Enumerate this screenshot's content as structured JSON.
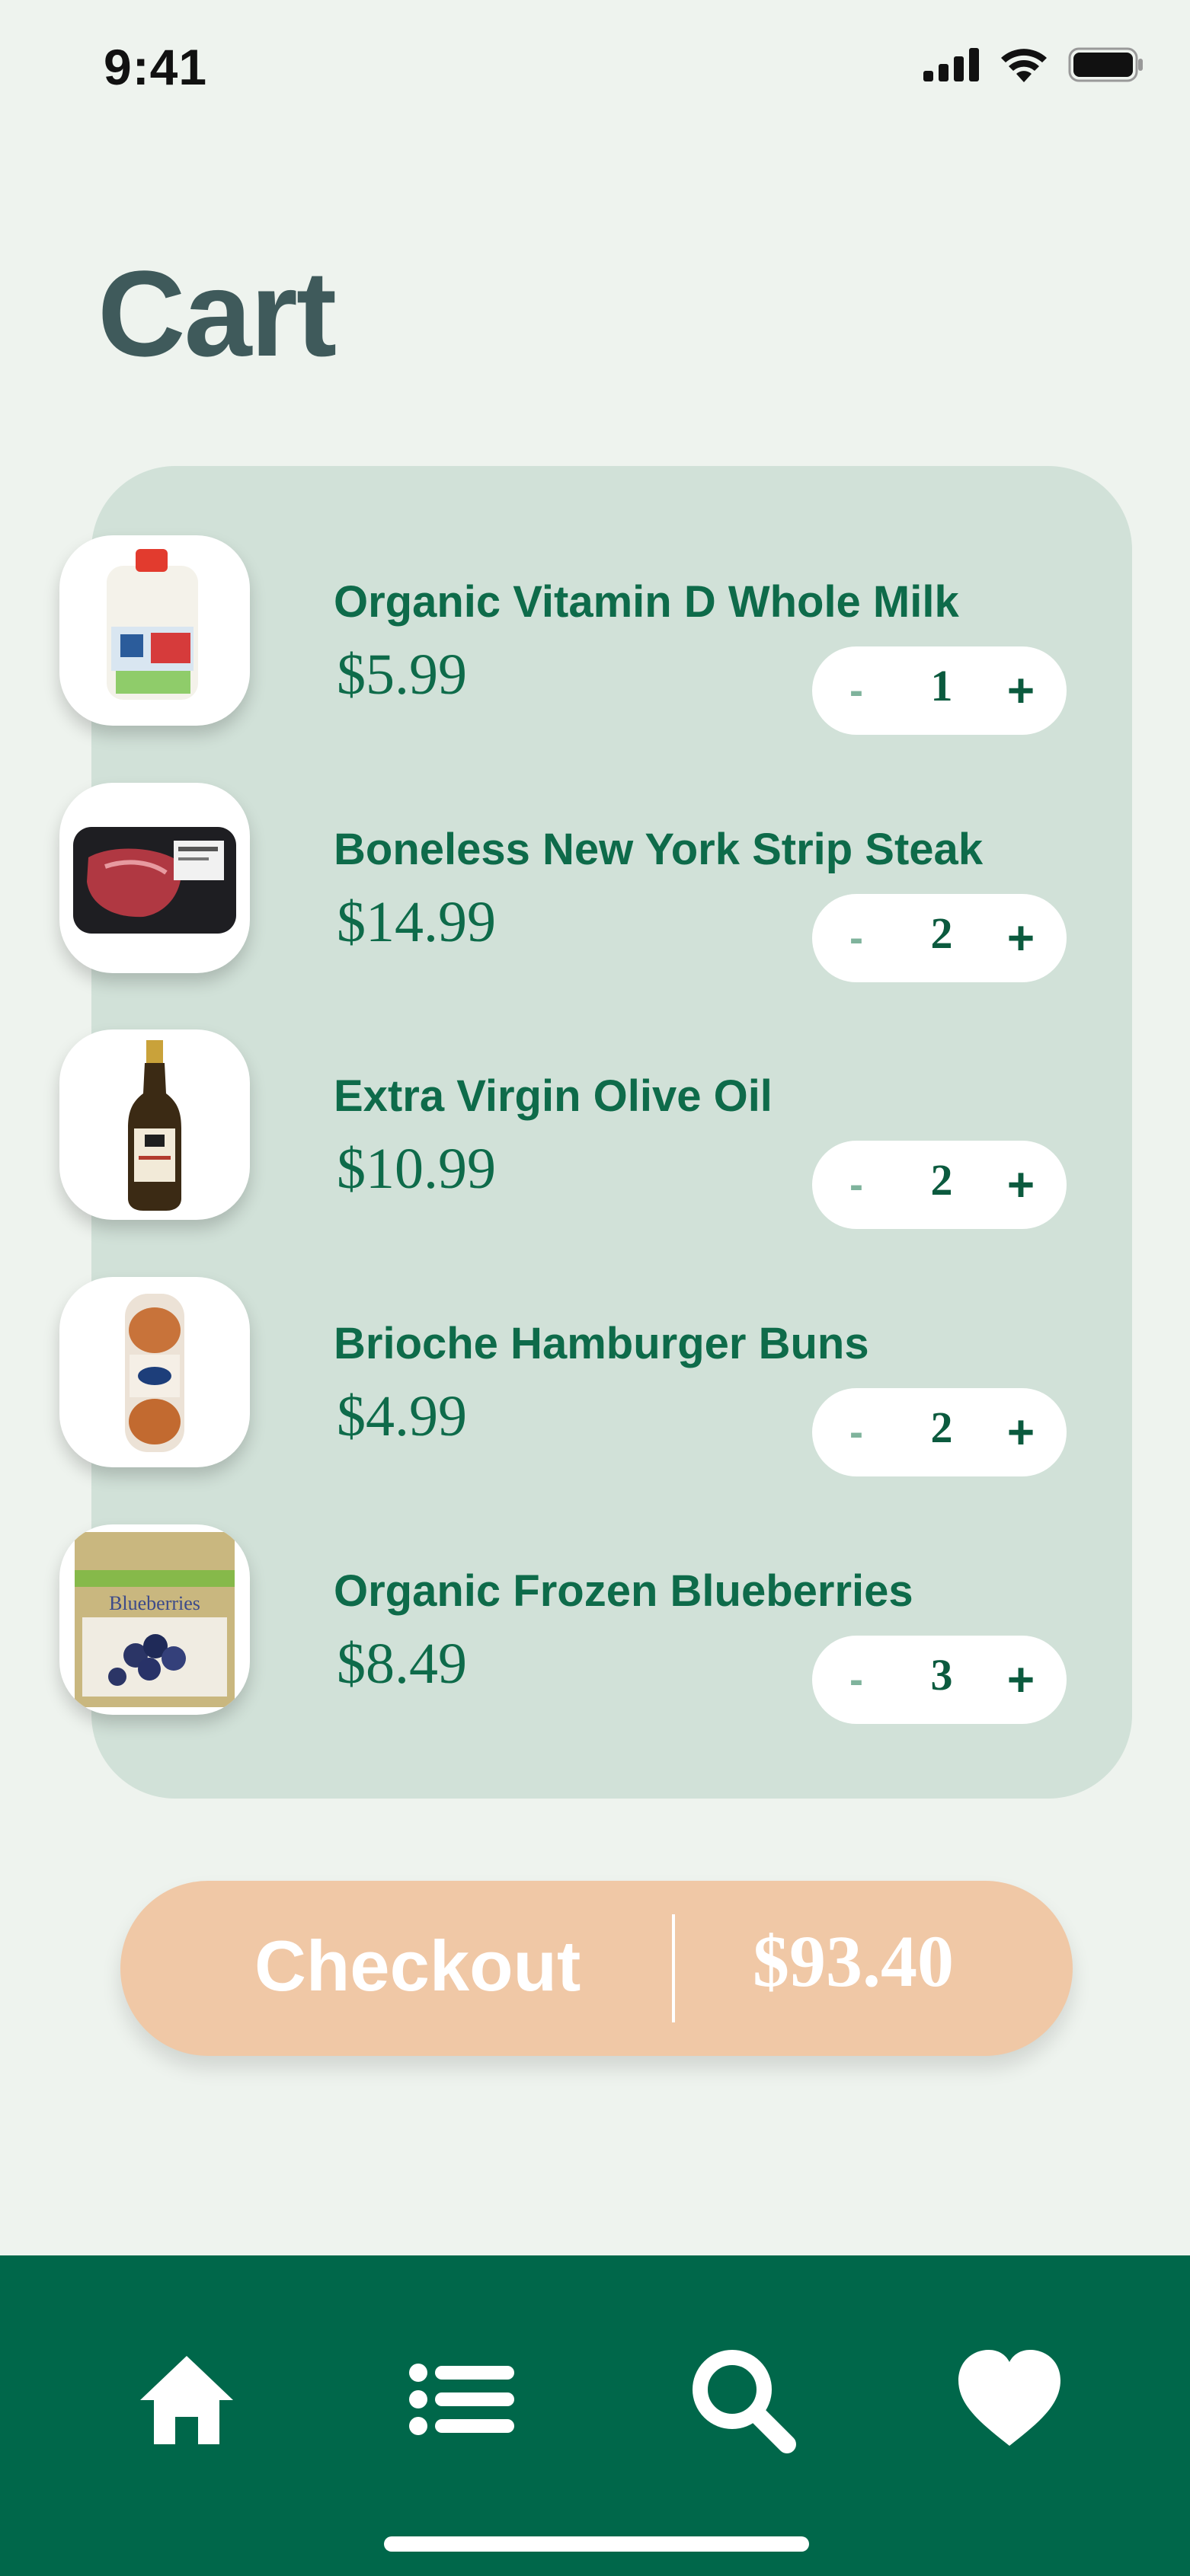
{
  "status_bar": {
    "time": "9:41",
    "icons": [
      "signal-icon",
      "wifi-icon",
      "battery-icon"
    ]
  },
  "page": {
    "title": "Cart"
  },
  "cart": {
    "items": [
      {
        "name": "Organic Vitamin D Whole Milk",
        "price": "$5.99",
        "quantity": "1",
        "image_icon": "milk-jug-image"
      },
      {
        "name": "Boneless New York Strip Steak",
        "price": "$14.99",
        "quantity": "2",
        "image_icon": "steak-package-image"
      },
      {
        "name": "Extra Virgin Olive Oil",
        "price": "$10.99",
        "quantity": "2",
        "image_icon": "olive-oil-bottle-image"
      },
      {
        "name": "Brioche Hamburger Buns",
        "price": "$4.99",
        "quantity": "2",
        "image_icon": "brioche-buns-image"
      },
      {
        "name": "Organic Frozen Blueberries",
        "price": "$8.49",
        "quantity": "3",
        "image_icon": "blueberries-bag-image"
      }
    ],
    "decrement_label": "-",
    "increment_label": "+"
  },
  "checkout": {
    "label": "Checkout",
    "total": "$93.40"
  },
  "nav": {
    "items": [
      {
        "icon": "home-icon"
      },
      {
        "icon": "list-icon"
      },
      {
        "icon": "search-icon"
      },
      {
        "icon": "heart-icon"
      }
    ]
  },
  "colors": {
    "background": "#eef3ee",
    "card": "#d1e1d8",
    "brand_green": "#00674a",
    "text_green": "#0e6b4a",
    "title": "#3f5a5b",
    "checkout": "#f0c8a6"
  },
  "thumb_labels": {
    "blueberries_bag": "Blueberries"
  }
}
